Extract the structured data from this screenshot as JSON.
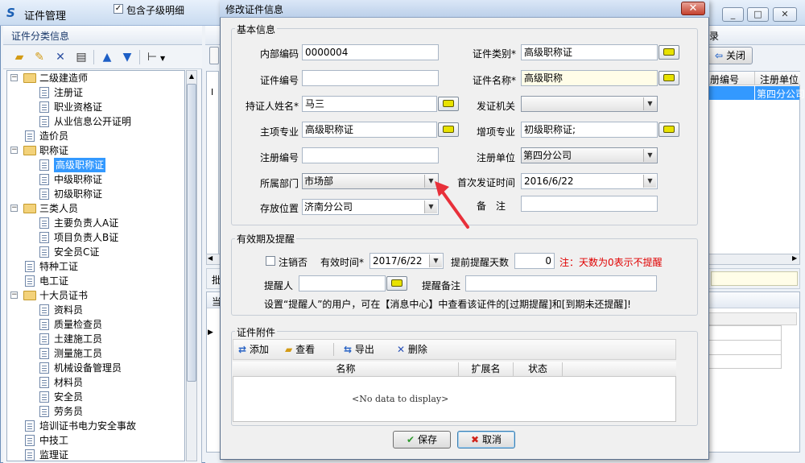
{
  "app": {
    "title": "证件管理"
  },
  "left": {
    "header": "证件分类信息",
    "include_sub_label": "包含子级明细",
    "include_sub_checked": true,
    "tree": [
      {
        "label": "二级建造师",
        "level": 0,
        "type": "folder",
        "expanded": true
      },
      {
        "label": "注册证",
        "level": 1,
        "type": "doc"
      },
      {
        "label": "职业资格证",
        "level": 1,
        "type": "doc"
      },
      {
        "label": "从业信息公开证明",
        "level": 1,
        "type": "doc"
      },
      {
        "label": "造价员",
        "level": 0,
        "type": "doc"
      },
      {
        "label": "职称证",
        "level": 0,
        "type": "folder",
        "expanded": true
      },
      {
        "label": "高级职称证",
        "level": 1,
        "type": "doc",
        "selected": true
      },
      {
        "label": "中级职称证",
        "level": 1,
        "type": "doc"
      },
      {
        "label": "初级职称证",
        "level": 1,
        "type": "doc"
      },
      {
        "label": "三类人员",
        "level": 0,
        "type": "folder",
        "expanded": true
      },
      {
        "label": "主要负责人A证",
        "level": 1,
        "type": "doc"
      },
      {
        "label": "项目负责人B证",
        "level": 1,
        "type": "doc"
      },
      {
        "label": "安全员C证",
        "level": 1,
        "type": "doc"
      },
      {
        "label": "特种工证",
        "level": 0,
        "type": "doc"
      },
      {
        "label": "电工证",
        "level": 0,
        "type": "doc"
      },
      {
        "label": "十大员证书",
        "level": 0,
        "type": "folder",
        "expanded": true
      },
      {
        "label": "资料员",
        "level": 1,
        "type": "doc"
      },
      {
        "label": "质量检查员",
        "level": 1,
        "type": "doc"
      },
      {
        "label": "土建施工员",
        "level": 1,
        "type": "doc"
      },
      {
        "label": "测量施工员",
        "level": 1,
        "type": "doc"
      },
      {
        "label": "机械设备管理员",
        "level": 1,
        "type": "doc"
      },
      {
        "label": "材料员",
        "level": 1,
        "type": "doc"
      },
      {
        "label": "安全员",
        "level": 1,
        "type": "doc"
      },
      {
        "label": "劳务员",
        "level": 1,
        "type": "doc"
      },
      {
        "label": "培训证书电力安全事故",
        "level": 0,
        "type": "doc"
      },
      {
        "label": "中技工",
        "level": 0,
        "type": "doc"
      },
      {
        "label": "监理证",
        "level": 0,
        "type": "doc"
      }
    ]
  },
  "right": {
    "header_tail": "录",
    "close_label": "关闭",
    "col_reg_no": "册编号",
    "col_reg_unit": "注册单位",
    "cell_reg_unit": "第四分公司",
    "row_marker": "I",
    "tab_hint_1": "批",
    "tab_hint_2": "当"
  },
  "dialog": {
    "title": "修改证件信息",
    "basic_group": "基本信息",
    "fields": {
      "internal_code": {
        "label": "内部编码",
        "value": "0000004"
      },
      "cert_type": {
        "label": "证件类别*",
        "value": "高级职称证"
      },
      "cert_no": {
        "label": "证件编号",
        "value": ""
      },
      "cert_name": {
        "label": "证件名称*",
        "value": "高级职称"
      },
      "holder": {
        "label": "持证人姓名*",
        "value": "马三"
      },
      "issuer": {
        "label": "发证机关",
        "value": ""
      },
      "major": {
        "label": "主项专业",
        "value": "高级职称证"
      },
      "extra_major": {
        "label": "增项专业",
        "value": "初级职称证;"
      },
      "reg_no": {
        "label": "注册编号",
        "value": ""
      },
      "reg_unit": {
        "label": "注册单位",
        "value": "第四分公司"
      },
      "dept": {
        "label": "所属部门",
        "value": "市场部"
      },
      "first_issue": {
        "label": "首次发证时间",
        "value": "2016/6/22"
      },
      "storage": {
        "label": "存放位置",
        "value": "济南分公司"
      },
      "remark": {
        "label": "备　注",
        "value": ""
      }
    },
    "validity_group": "有效期及提醒",
    "cancel_label": "注销否",
    "cancel_checked": false,
    "valid_time_label": "有效时间*",
    "valid_time_value": "2017/6/22",
    "remind_days_label": "提前提醒天数",
    "remind_days_value": "0",
    "remind_note": "注：天数为0表示不提醒",
    "reminder_label": "提醒人",
    "reminder_value": "",
    "remind_memo_label": "提醒备注",
    "remind_memo_value": "",
    "hint": "设置“提醒人”的用户，可在【消息中心】中查看该证件的[过期提醒]和[到期未还提醒]!",
    "attach_group": "证件附件",
    "attach_toolbar": {
      "add": "添加",
      "view": "查看",
      "export": "导出",
      "delete": "删除"
    },
    "grid_columns": [
      "名称",
      "扩展名",
      "状态"
    ],
    "grid_empty": "<No data to display>",
    "save_label": "保存",
    "cancel_btn_label": "取消"
  },
  "colors": {
    "accent": "#3399ff",
    "note_red": "#e00000",
    "arrow_red": "#e8303a",
    "title_gradient_top": "#dbe7f7"
  }
}
